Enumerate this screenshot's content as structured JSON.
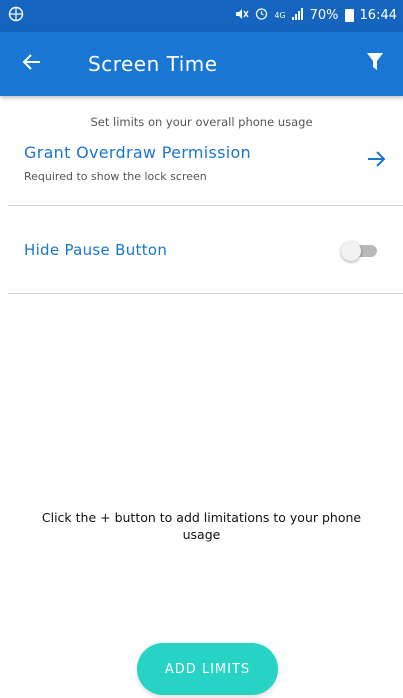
{
  "status_bar": {
    "battery_percent": "70%",
    "time": "16:44",
    "network": "4G",
    "icons": [
      "globe-icon",
      "mute-icon",
      "alarm-icon",
      "network-4g-icon",
      "signal-icon",
      "battery-icon"
    ]
  },
  "app_bar": {
    "title": "Screen Time",
    "back_icon": "arrow-left-icon",
    "filter_icon": "filter-icon"
  },
  "settings": {
    "subtitle": "Set limits on your overall phone usage",
    "overdraw": {
      "title": "Grant Overdraw Permission",
      "description": "Required to show the lock screen",
      "icon": "arrow-right-icon"
    },
    "pause": {
      "label": "Hide Pause Button",
      "enabled": false
    }
  },
  "empty_state": {
    "message": "Click the + button to add limitations to your phone usage"
  },
  "fab": {
    "label": "ADD LIMITS"
  },
  "colors": {
    "status_bar": "#1565c0",
    "app_bar": "#1976d2",
    "accent_text": "#1976d2",
    "fab": "#26d3c4"
  }
}
